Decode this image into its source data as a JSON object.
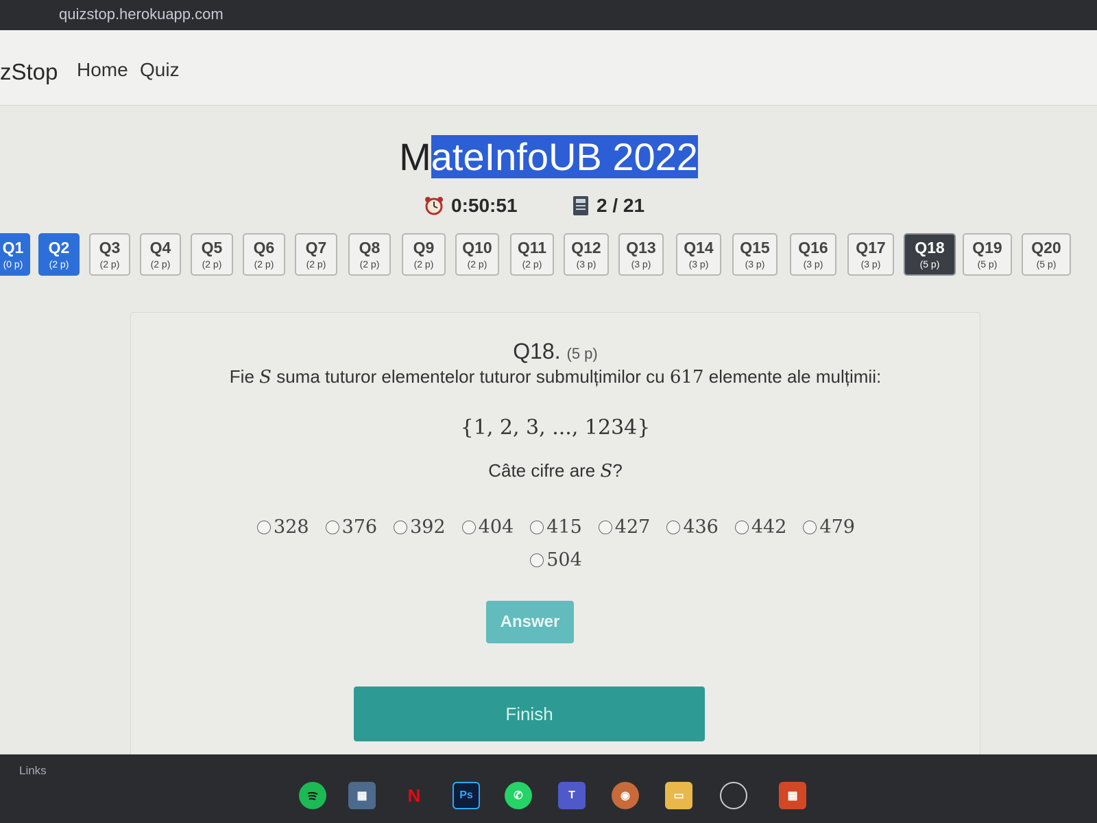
{
  "browser": {
    "url": "quizstop.herokuapp.com"
  },
  "navbar": {
    "brand": "zStop",
    "links": [
      "Home",
      "Quiz"
    ]
  },
  "quiz": {
    "title_plain": "M",
    "title_selected": "ateInfoUB 2022",
    "timer": "0:50:51",
    "progress": "2 / 21"
  },
  "question_nav": [
    {
      "label": "Q1",
      "points": "(0 p)",
      "state": "done"
    },
    {
      "label": "Q2",
      "points": "(2 p)",
      "state": "done"
    },
    {
      "label": "Q3",
      "points": "(2 p)",
      "state": "pending"
    },
    {
      "label": "Q4",
      "points": "(2 p)",
      "state": "pending"
    },
    {
      "label": "Q5",
      "points": "(2 p)",
      "state": "pending"
    },
    {
      "label": "Q6",
      "points": "(2 p)",
      "state": "pending"
    },
    {
      "label": "Q7",
      "points": "(2 p)",
      "state": "pending"
    },
    {
      "label": "Q8",
      "points": "(2 p)",
      "state": "pending"
    },
    {
      "label": "Q9",
      "points": "(2 p)",
      "state": "pending"
    },
    {
      "label": "Q10",
      "points": "(2 p)",
      "state": "pending"
    },
    {
      "label": "Q11",
      "points": "(2 p)",
      "state": "pending"
    },
    {
      "label": "Q12",
      "points": "(3 p)",
      "state": "pending"
    },
    {
      "label": "Q13",
      "points": "(3 p)",
      "state": "pending"
    },
    {
      "label": "Q14",
      "points": "(3 p)",
      "state": "pending"
    },
    {
      "label": "Q15",
      "points": "(3 p)",
      "state": "pending"
    },
    {
      "label": "Q16",
      "points": "(3 p)",
      "state": "pending"
    },
    {
      "label": "Q17",
      "points": "(3 p)",
      "state": "pending"
    },
    {
      "label": "Q18",
      "points": "(5 p)",
      "state": "active"
    },
    {
      "label": "Q19",
      "points": "(5 p)",
      "state": "pending"
    },
    {
      "label": "Q20",
      "points": "(5 p)",
      "state": "pending"
    }
  ],
  "question": {
    "number": "Q18.",
    "points": "(5 p)",
    "text_prefix": "Fie",
    "text_var": "S",
    "text_mid": "suma tuturor elementelor tuturor submulțimilor cu",
    "text_num": "617",
    "text_suffix": "elemente ale mulțimii:",
    "set": "{1, 2, 3, ..., 1234}",
    "ask_prefix": "Câte cifre are",
    "ask_var": "S",
    "ask_suffix": "?",
    "options": [
      "328",
      "376",
      "392",
      "404",
      "415",
      "427",
      "436",
      "442",
      "479",
      "504"
    ],
    "answer_button": "Answer",
    "finish_button": "Finish"
  },
  "taskbar": {
    "links_label": "Links",
    "apps": [
      "spotify-icon",
      "store-icon",
      "netflix-icon",
      "photoshop-icon",
      "whatsapp-icon",
      "teams-icon",
      "browser-icon",
      "explorer-icon",
      "search-icon",
      "office-icon"
    ]
  }
}
